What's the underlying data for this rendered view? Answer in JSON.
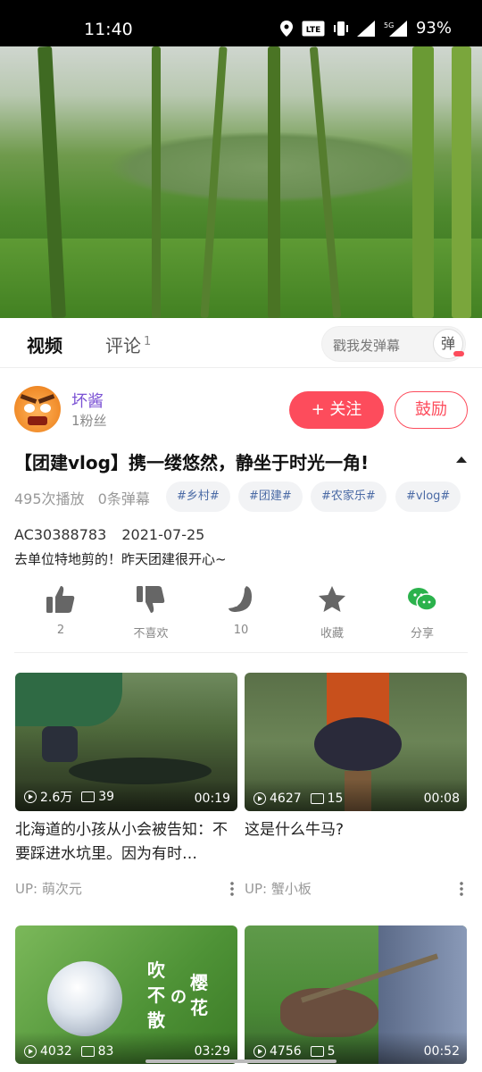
{
  "status_bar": {
    "time": "11:40",
    "battery": "93%",
    "network": "5G",
    "volte": "VoLTE 2"
  },
  "tabs": {
    "video": "视频",
    "comment": "评论",
    "comment_count": "1"
  },
  "danmu": {
    "placeholder": "戳我发弹幕",
    "toggle": "弹"
  },
  "uploader": {
    "name": "坏酱",
    "fans": "1粉丝",
    "follow": "+ 关注",
    "cheer": "鼓励"
  },
  "video": {
    "title": "【团建vlog】携一缕悠然，静坐于时光一角!",
    "plays": "495次播放",
    "danmaku": "0条弹幕",
    "tags": [
      "#乡村#",
      "#团建#",
      "#农家乐#",
      "#vlog#"
    ],
    "ac_id": "AC30388783",
    "date": "2021-07-25",
    "description": "去单位特地剪的！昨天团建很开心~"
  },
  "actions": [
    {
      "icon": "thumbs-up-icon",
      "label": "2"
    },
    {
      "icon": "thumbs-down-icon",
      "label": "不喜欢"
    },
    {
      "icon": "banana-icon",
      "label": "10"
    },
    {
      "icon": "star-icon",
      "label": "收藏"
    },
    {
      "icon": "wechat-icon",
      "label": "分享"
    }
  ],
  "recommendations": [
    {
      "plays": "2.6万",
      "danmaku": "39",
      "duration": "00:19",
      "title": "北海道的小孩从小会被告知：不要踩进水坑里。因为有时…",
      "up": "UP: 萌次元"
    },
    {
      "plays": "4627",
      "danmaku": "15",
      "duration": "00:08",
      "title": "这是什么牛马?",
      "up": "UP: 蟹小板"
    },
    {
      "plays": "4032",
      "danmaku": "83",
      "duration": "03:29",
      "thumb_text": [
        "吹",
        "不",
        "散",
        "の",
        "樱",
        "花"
      ]
    },
    {
      "plays": "4756",
      "danmaku": "5",
      "duration": "00:52"
    }
  ],
  "colors": {
    "accent": "#fd4c5c",
    "uploader_name": "#7b52d4",
    "tag_text": "#4a6aa5",
    "share_green": "#2bb24c"
  }
}
